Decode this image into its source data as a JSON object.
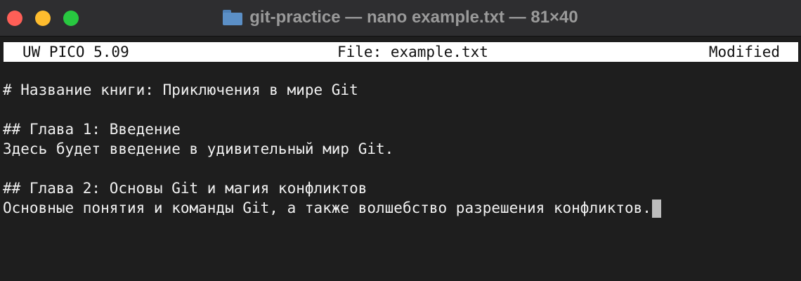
{
  "window": {
    "title": "git-practice — nano example.txt — 81×40",
    "colors": {
      "close": "#ff5f57",
      "minimize": "#febc2e",
      "zoom": "#28c840"
    }
  },
  "editor": {
    "app_version": "UW PICO 5.09",
    "file_label": "File: example.txt",
    "status": "Modified",
    "lines": [
      "# Название книги: Приключения в мире Git",
      "",
      "## Глава 1: Введение",
      "Здесь будет введение в удивительный мир Git.",
      "",
      "## Глава 2: Основы Git и магия конфликтов",
      "Основные понятия и команды Git, а также волшебство разрешения конфликтов."
    ]
  }
}
